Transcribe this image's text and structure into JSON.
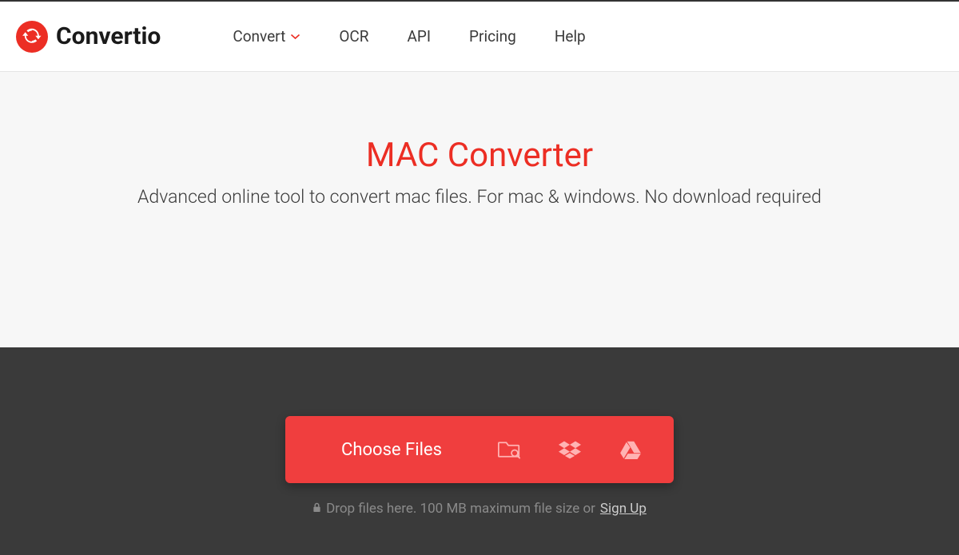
{
  "brand": {
    "name": "Convertio"
  },
  "nav": {
    "convert": "Convert",
    "ocr": "OCR",
    "api": "API",
    "pricing": "Pricing",
    "help": "Help"
  },
  "hero": {
    "title": "MAC Converter",
    "subtitle": "Advanced online tool to convert mac files. For mac & windows. No download required"
  },
  "upload": {
    "choose_label": "Choose Files",
    "hint_prefix": "Drop files here. 100 MB maximum file size or ",
    "signup": "Sign Up"
  }
}
